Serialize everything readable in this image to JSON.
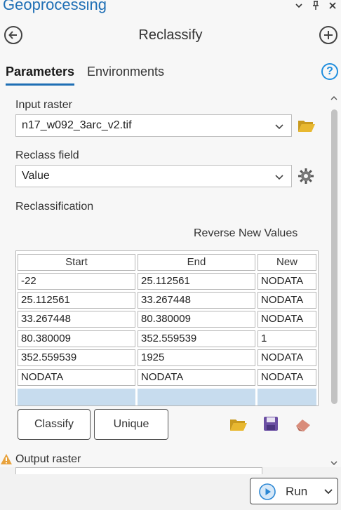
{
  "app_title": "Geoprocessing",
  "tool_title": "Reclassify",
  "tabs": {
    "parameters": "Parameters",
    "environments": "Environments"
  },
  "help_label": "?",
  "input_raster": {
    "label": "Input raster",
    "value": "n17_w092_3arc_v2.tif"
  },
  "reclass_field": {
    "label": "Reclass field",
    "value": "Value"
  },
  "reclassification": {
    "label": "Reclassification",
    "reverse_label": "Reverse New Values",
    "columns": [
      "Start",
      "End",
      "New"
    ],
    "rows": [
      [
        "-22",
        "25.112561",
        "NODATA"
      ],
      [
        "25.112561",
        "33.267448",
        "NODATA"
      ],
      [
        "33.267448",
        "80.380009",
        "NODATA"
      ],
      [
        "80.380009",
        "352.559539",
        "1"
      ],
      [
        "352.559539",
        "1925",
        "NODATA"
      ],
      [
        "NODATA",
        "NODATA",
        "NODATA"
      ]
    ],
    "buttons": {
      "classify": "Classify",
      "unique": "Unique"
    }
  },
  "output_raster": {
    "label": "Output raster"
  },
  "run_label": "Run",
  "colors": {
    "accent": "#1f6fb5",
    "help": "#1f8ede",
    "folder": "#e8b830",
    "save": "#6b4fa3",
    "eraser": "#d98c7a",
    "warning": "#e8a23c",
    "empty_row": "#c7dcee"
  }
}
